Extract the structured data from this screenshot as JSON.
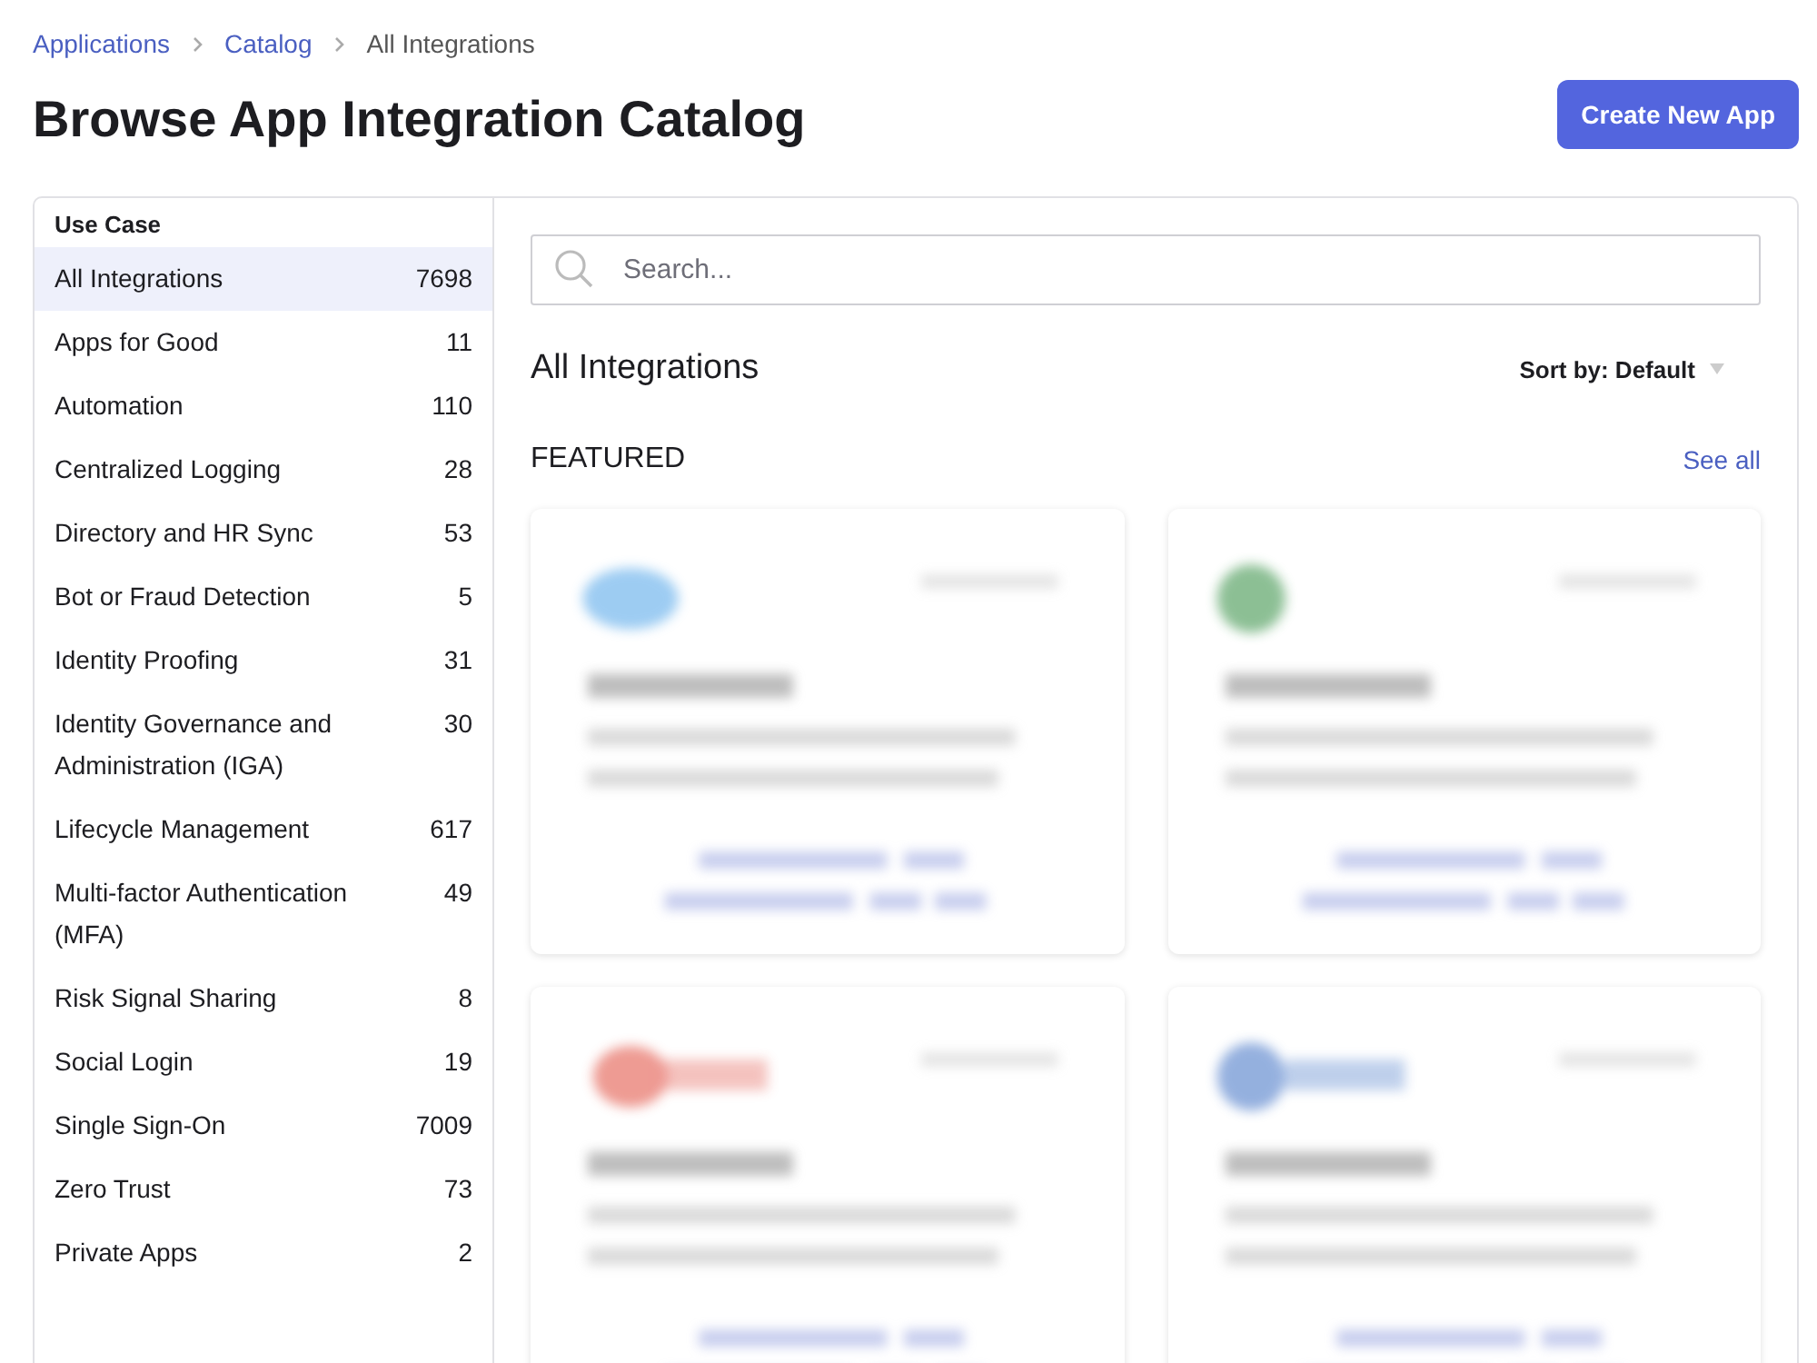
{
  "breadcrumbs": [
    {
      "label": "Applications",
      "link": true
    },
    {
      "label": "Catalog",
      "link": true
    },
    {
      "label": "All Integrations",
      "link": false
    }
  ],
  "title": "Browse App Integration Catalog",
  "create_button": "Create New App",
  "sidebar": {
    "heading": "Use Case",
    "items": [
      {
        "label": "All Integrations",
        "count": "7698",
        "selected": true
      },
      {
        "label": "Apps for Good",
        "count": "11",
        "selected": false
      },
      {
        "label": "Automation",
        "count": "110",
        "selected": false
      },
      {
        "label": "Centralized Logging",
        "count": "28",
        "selected": false
      },
      {
        "label": "Directory and HR Sync",
        "count": "53",
        "selected": false
      },
      {
        "label": "Bot or Fraud Detection",
        "count": "5",
        "selected": false
      },
      {
        "label": "Identity Proofing",
        "count": "31",
        "selected": false
      },
      {
        "label": "Identity Governance and Administration (IGA)",
        "count": "30",
        "selected": false
      },
      {
        "label": "Lifecycle Management",
        "count": "617",
        "selected": false
      },
      {
        "label": "Multi-factor Authentication (MFA)",
        "count": "49",
        "selected": false
      },
      {
        "label": "Risk Signal Sharing",
        "count": "8",
        "selected": false
      },
      {
        "label": "Social Login",
        "count": "19",
        "selected": false
      },
      {
        "label": "Single Sign-On",
        "count": "7009",
        "selected": false
      },
      {
        "label": "Zero Trust",
        "count": "73",
        "selected": false
      },
      {
        "label": "Private Apps",
        "count": "2",
        "selected": false
      }
    ]
  },
  "search": {
    "placeholder": "Search..."
  },
  "section_title": "All Integrations",
  "sort": "Sort by: Default",
  "featured": {
    "heading": "FEATURED",
    "see_all": "See all"
  }
}
